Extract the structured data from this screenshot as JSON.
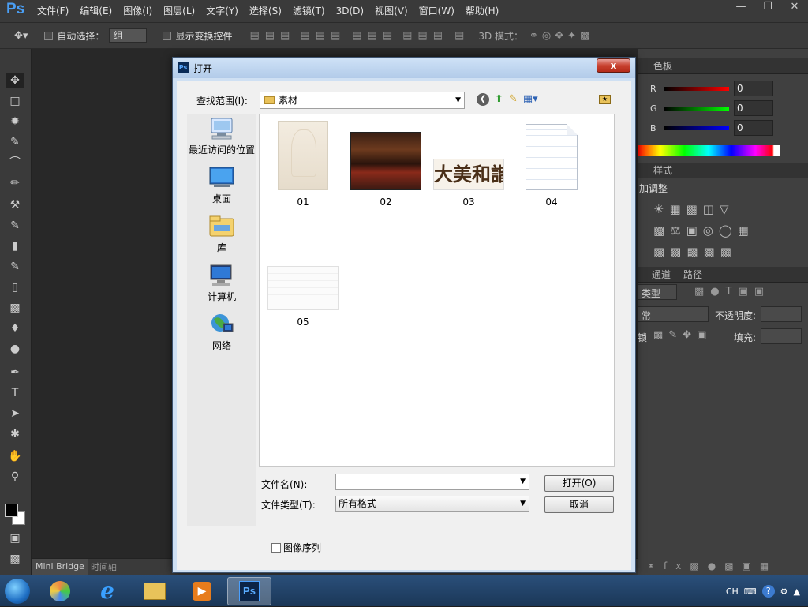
{
  "app": {
    "logo": "Ps"
  },
  "menubar": {
    "items": [
      "文件(F)",
      "编辑(E)",
      "图像(I)",
      "图层(L)",
      "文字(Y)",
      "选择(S)",
      "滤镜(T)",
      "3D(D)",
      "视图(V)",
      "窗口(W)",
      "帮助(H)"
    ]
  },
  "options": {
    "auto_select_label": "自动选择：",
    "auto_select_value": "组",
    "show_transform_label": "显示变换控件",
    "mode_3d_label": "3D 模式："
  },
  "bottom_tabs": [
    "Mini Bridge",
    "时间轴"
  ],
  "right_panel": {
    "color_tabs": [
      "色板"
    ],
    "channels": [
      {
        "name": "R",
        "value": "0"
      },
      {
        "name": "G",
        "value": "0"
      },
      {
        "name": "B",
        "value": "0"
      }
    ],
    "adjust_tabs": [
      "样式"
    ],
    "adjust_title": "加调整",
    "layer_tabs": [
      "通道",
      "路径"
    ],
    "kind_label": "类型",
    "blend_label": "常",
    "opacity_label": "不透明度:",
    "lock_label": "锁",
    "fill_label": "填充:"
  },
  "dialog": {
    "title": "打开",
    "close_label": "x",
    "look_in_label": "查找范围(I):",
    "look_in_value": "素材",
    "places": [
      {
        "label": "最近访问的位置",
        "icon": "recent-places-icon"
      },
      {
        "label": "桌面",
        "icon": "desktop-icon"
      },
      {
        "label": "库",
        "icon": "libraries-icon"
      },
      {
        "label": "计算机",
        "icon": "computer-icon"
      },
      {
        "label": "网络",
        "icon": "network-icon"
      }
    ],
    "files": [
      {
        "name": "01",
        "kind": "sketch-image"
      },
      {
        "name": "02",
        "kind": "concert-photo"
      },
      {
        "name": "03",
        "kind": "calligraphy-image"
      },
      {
        "name": "04",
        "kind": "document"
      },
      {
        "name": "05",
        "kind": "table-image"
      }
    ],
    "calligraphy_text": "大美和諧",
    "file_name_label": "文件名(N):",
    "file_name_value": "",
    "file_type_label": "文件类型(T):",
    "file_type_value": "所有格式",
    "open_button": "打开(O)",
    "cancel_button": "取消",
    "image_sequence_label": "图像序列"
  },
  "taskbar": {
    "tray_lang": "CH"
  }
}
